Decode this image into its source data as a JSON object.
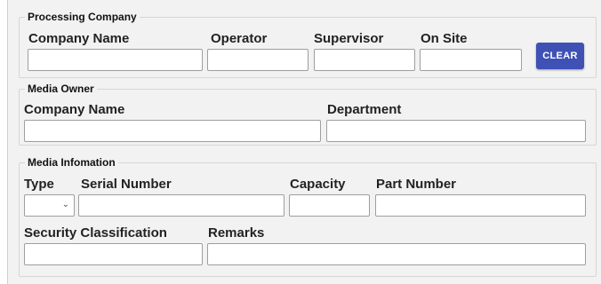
{
  "processing_company": {
    "legend": "Processing Company",
    "company_name_label": "Company Name",
    "company_name_value": "",
    "operator_label": "Operator",
    "operator_value": "",
    "supervisor_label": "Supervisor",
    "supervisor_value": "",
    "on_site_label": "On Site",
    "on_site_value": "",
    "clear_label": "CLEAR"
  },
  "media_owner": {
    "legend": "Media Owner",
    "company_name_label": "Company Name",
    "company_name_value": "",
    "department_label": "Department",
    "department_value": ""
  },
  "media_information": {
    "legend": "Media Infomation",
    "type_label": "Type",
    "type_value": "",
    "serial_number_label": "Serial Number",
    "serial_number_value": "",
    "capacity_label": "Capacity",
    "capacity_value": "",
    "part_number_label": "Part Number",
    "part_number_value": "",
    "security_classification_label": "Security Classification",
    "security_classification_value": "",
    "remarks_label": "Remarks",
    "remarks_value": ""
  },
  "colors": {
    "accent": "#3f51b5",
    "panel_background": "#f2f2f2"
  },
  "icons": {
    "type_dropdown": "chevron-down-icon"
  }
}
